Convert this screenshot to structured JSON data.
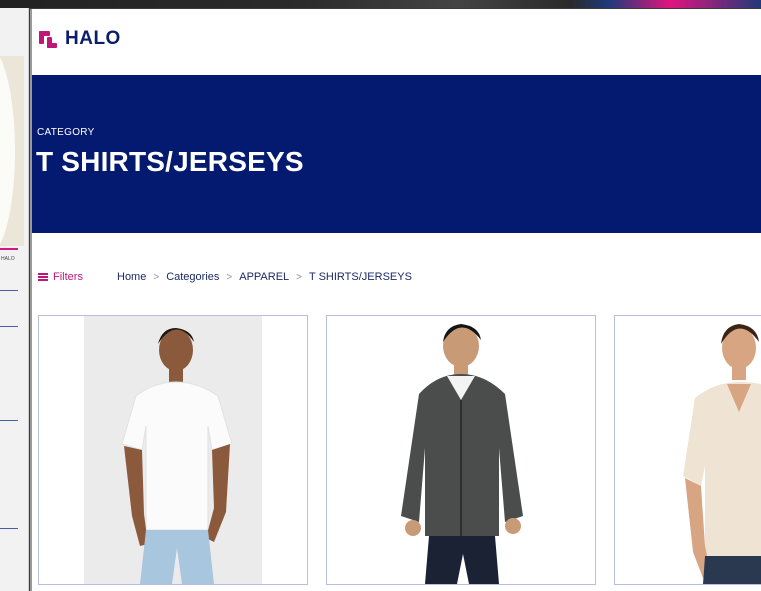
{
  "site": {
    "logo_text": "HALO",
    "brand_colors": {
      "navy": "#031a70",
      "magenta": "#c0167a"
    }
  },
  "hero": {
    "eyebrow": "CATEGORY",
    "title": "T SHIRTS/JERSEYS"
  },
  "toolbar": {
    "filters_label": "Filters",
    "filters_icon": "filter-lines-icon"
  },
  "breadcrumb": {
    "items": [
      "Home",
      "Categories",
      "APPAREL",
      "T SHIRTS/JERSEYS"
    ],
    "separator": ">"
  },
  "products": [
    {
      "image": "man in white t-shirt and light jeans",
      "icon": "product-photo"
    },
    {
      "image": "man in charcoal full-zip hoodie",
      "icon": "product-photo"
    },
    {
      "image": "man in cream v-neck t-shirt",
      "icon": "product-photo"
    }
  ],
  "background_window": {
    "label": "HALO"
  }
}
